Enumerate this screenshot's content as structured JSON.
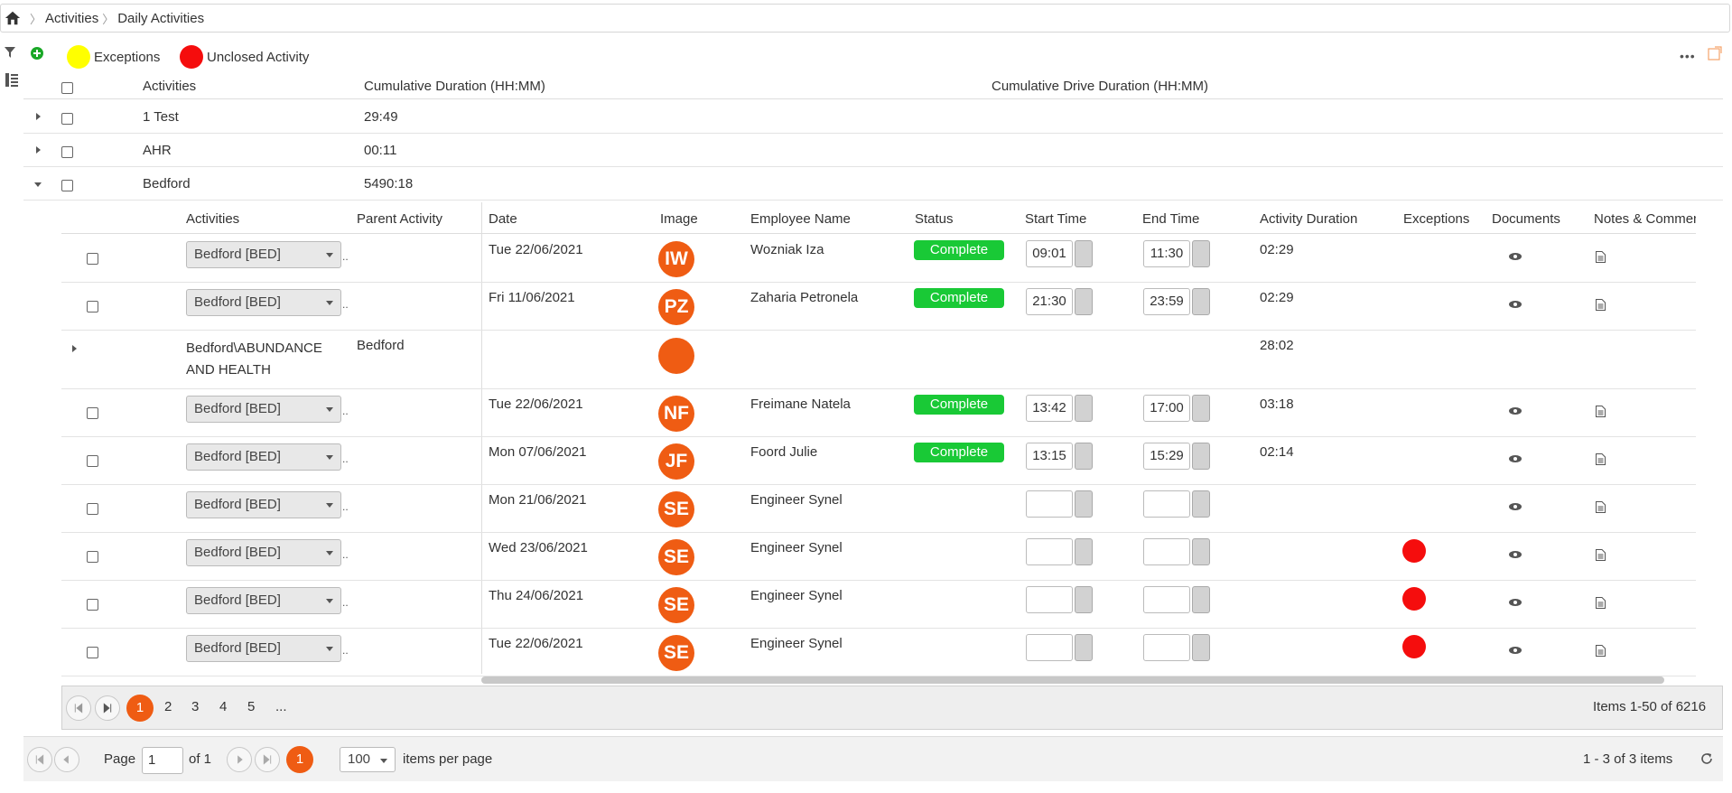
{
  "breadcrumb": {
    "items": [
      "Activities",
      "Daily Activities"
    ]
  },
  "legend": {
    "exceptions_label": "Exceptions",
    "exceptions_color": "#ffff00",
    "unclosed_label": "Unclosed Activity",
    "unclosed_color": "#f50d0d"
  },
  "outer": {
    "headers": {
      "activities": "Activities",
      "cum_duration": "Cumulative Duration (HH:MM)",
      "cum_drive": "Cumulative Drive Duration (HH:MM)"
    },
    "rows": [
      {
        "name": "1 Test",
        "duration": "29:49"
      },
      {
        "name": "AHR",
        "duration": "00:11"
      },
      {
        "name": "Bedford",
        "duration": "5490:18"
      }
    ]
  },
  "inner": {
    "headers": {
      "activities": "Activities",
      "parent": "Parent Activity",
      "date": "Date",
      "image": "Image",
      "employee": "Employee Name",
      "status": "Status",
      "start": "Start Time",
      "end": "End Time",
      "duration": "Activity Duration",
      "exceptions": "Exceptions",
      "documents": "Documents",
      "notes": "Notes & Comment"
    },
    "rows": [
      {
        "activity": "Bedford [BED]",
        "date": "Tue 22/06/2021",
        "initials": "IW",
        "employee": "Wozniak Iza",
        "status": "Complete",
        "start": "09:01",
        "end": "11:30",
        "duration": "02:29"
      },
      {
        "activity": "Bedford [BED]",
        "date": "Fri 11/06/2021",
        "initials": "PZ",
        "employee": "Zaharia Petronela",
        "status": "Complete",
        "start": "21:30",
        "end": "23:59",
        "duration": "02:29"
      },
      {
        "activity_line1": "Bedford\\ABUNDANCE",
        "activity_line2": "AND HEALTH",
        "parent": "Bedford",
        "duration": "28:02"
      },
      {
        "activity": "Bedford [BED]",
        "date": "Tue 22/06/2021",
        "initials": "NF",
        "employee": "Freimane Natela",
        "status": "Complete",
        "start": "13:42",
        "end": "17:00",
        "duration": "03:18"
      },
      {
        "activity": "Bedford [BED]",
        "date": "Mon 07/06/2021",
        "initials": "JF",
        "employee": "Foord Julie",
        "status": "Complete",
        "start": "13:15",
        "end": "15:29",
        "duration": "02:14"
      },
      {
        "activity": "Bedford [BED]",
        "date": "Mon 21/06/2021",
        "initials": "SE",
        "employee": "Engineer Synel"
      },
      {
        "activity": "Bedford [BED]",
        "date": "Wed 23/06/2021",
        "initials": "SE",
        "employee": "Engineer Synel",
        "exception": true
      },
      {
        "activity": "Bedford [BED]",
        "date": "Thu 24/06/2021",
        "initials": "SE",
        "employee": "Engineer Synel",
        "exception": true
      },
      {
        "activity": "Bedford [BED]",
        "date": "Tue 22/06/2021",
        "initials": "SE",
        "employee": "Engineer Synel",
        "exception": true
      }
    ],
    "ellipsis": "..",
    "accent_color": "#ef5c13",
    "status_color": "#19c936"
  },
  "pager_inner": {
    "pages": [
      "1",
      "2",
      "3",
      "4",
      "5",
      "..."
    ],
    "summary": "Items 1-50 of 6216"
  },
  "pager_outer": {
    "page_label": "Page",
    "page_value": "1",
    "of_label": "of 1",
    "current": "1",
    "per_page": "100",
    "per_page_label": "items per page",
    "summary": "1 - 3 of 3 items"
  }
}
